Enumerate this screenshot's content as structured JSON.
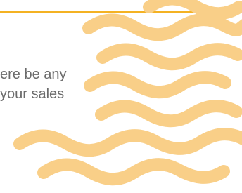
{
  "slide": {
    "text_lines": [
      "ere be any",
      "your sales"
    ],
    "accent_color": "#f4b223",
    "wave_color": "#f9cf88",
    "text_color": "#6b6b6b"
  }
}
